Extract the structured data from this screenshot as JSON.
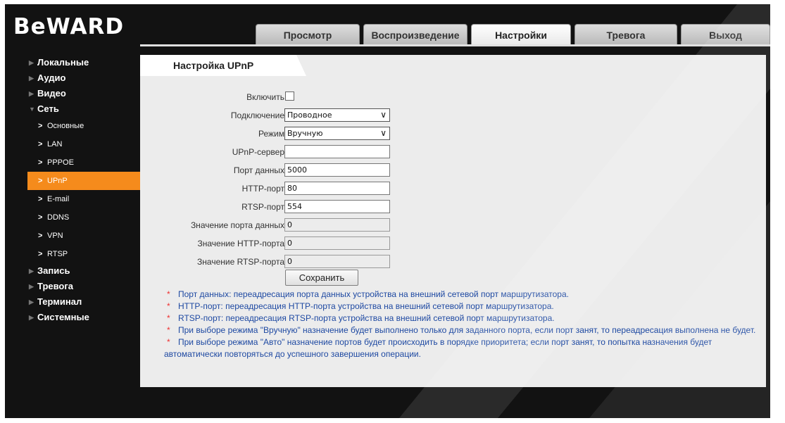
{
  "brand": {
    "logo_text": "BeWARD"
  },
  "tabs": [
    {
      "label": "Просмотр"
    },
    {
      "label": "Воспроизведение"
    },
    {
      "label": "Настройки"
    },
    {
      "label": "Тревога"
    },
    {
      "label": "Выход"
    }
  ],
  "sidebar": {
    "categories": [
      {
        "label": "Локальные"
      },
      {
        "label": "Аудио"
      },
      {
        "label": "Видео"
      },
      {
        "label": "Сеть"
      }
    ],
    "net_items": [
      {
        "label": "Основные"
      },
      {
        "label": "LAN"
      },
      {
        "label": "PPPOE"
      },
      {
        "label": "UPnP"
      },
      {
        "label": "E-mail"
      },
      {
        "label": "DDNS"
      },
      {
        "label": "VPN"
      },
      {
        "label": "RTSP"
      }
    ],
    "bottom_categories": [
      {
        "label": "Запись"
      },
      {
        "label": "Тревога"
      },
      {
        "label": "Терминал"
      },
      {
        "label": "Системные"
      }
    ]
  },
  "page": {
    "title": "Настройка UPnP"
  },
  "form": {
    "enable_label": "Включить",
    "connection_label": "Подключение",
    "connection_value": "Проводное",
    "mode_label": "Режим",
    "mode_value": "Вручную",
    "server_label": "UPnP-сервер",
    "server_value": "",
    "data_port_label": "Порт данных",
    "data_port_value": "5000",
    "http_port_label": "HTTP-порт",
    "http_port_value": "80",
    "rtsp_port_label": "RTSP-порт",
    "rtsp_port_value": "554",
    "data_port_result_label": "Значение порта данных",
    "data_port_result_value": "0",
    "http_port_result_label": "Значение HTTP-порта",
    "http_port_result_value": "0",
    "rtsp_port_result_label": "Значение RTSP-порта",
    "rtsp_port_result_value": "0",
    "save_label": "Сохранить"
  },
  "notes": [
    {
      "text": "Порт данных: переадресация порта данных устройства на внешний сетевой порт маршрутизатора."
    },
    {
      "text": "HTTP-порт: переадресация HTTP-порта устройства на внешний сетевой порт маршрутизатора."
    },
    {
      "text": "RTSP-порт: переадресация RTSP-порта устройства на внешний сетевой порт маршрутизатора."
    },
    {
      "text": "При выборе режима \"Вручную\" назначение будет выполнено только для заданного порта, если порт занят, то переадресация выполнена не будет."
    },
    {
      "text": "При выборе режима \"Авто\" назначение портов будет происходить в порядке приоритета; если порт занят, то попытка назначения будет автоматически повторяться до успешного завершения операции."
    }
  ],
  "colors": {
    "accent": "#f58b1c",
    "note_text": "#1e49a2",
    "asterisk": "#ee3333",
    "background": "#121212"
  }
}
